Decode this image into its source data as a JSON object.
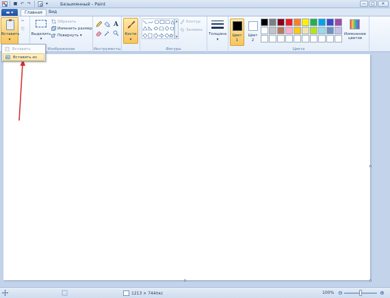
{
  "window": {
    "title": "Безымянный - Paint",
    "minimize": "—",
    "maximize": "□",
    "close": "✕"
  },
  "qat": {
    "save": "■",
    "undo": "↶",
    "redo": "↷",
    "more": "▾"
  },
  "tabs": {
    "app_menu": "▬ ▾",
    "home": "Главная",
    "view": "Вид"
  },
  "ribbon": {
    "clipboard": {
      "paste": "Вставить",
      "paste_arrow": "▾",
      "cut": "✂",
      "copy": "⎘",
      "label": ""
    },
    "image": {
      "select": "Выделить",
      "select_arrow": "▾",
      "crop": "Обрезать",
      "resize": "Изменить размер",
      "rotate": "Повернуть",
      "rotate_arrow": "▾",
      "label": "Изображения"
    },
    "tools": {
      "label": "Инструменты"
    },
    "brushes": {
      "label": "Кисти",
      "arrow": "▾"
    },
    "shapes": {
      "outline": "Контур",
      "fill": "Заливка",
      "label": "Фигуры"
    },
    "size": {
      "label": "Толщина",
      "arrow": "▾"
    },
    "colors": {
      "color1": "Цвет\n1",
      "color1_a": "Цвет",
      "color1_b": "1",
      "color2_a": "Цвет",
      "color2_b": "2",
      "edit": "Изменение цветов",
      "label": "Цвета",
      "color1_value": "#000000",
      "color2_value": "#ffffff",
      "palette_row1": [
        "#000000",
        "#7f7f7f",
        "#880015",
        "#ed1c24",
        "#ff7f27",
        "#fff200",
        "#22b14c",
        "#00a2e8",
        "#3f48cc",
        "#a349a4"
      ],
      "palette_row2": [
        "#ffffff",
        "#c3c3c3",
        "#b97a57",
        "#ffaec9",
        "#ffc90e",
        "#efe4b0",
        "#b5e61d",
        "#99d9ea",
        "#7092be",
        "#c8bfe7"
      ]
    }
  },
  "paste_menu": {
    "paste": "Вставить",
    "paste_from": "Вставить из"
  },
  "status": {
    "canvas_size": "1213 × 744пкс",
    "zoom": "100%",
    "zoom_out": "⊖",
    "zoom_in": "⊕"
  }
}
